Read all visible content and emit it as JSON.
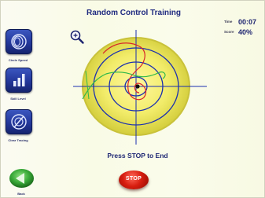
{
  "header": {
    "title": "Random Control Training"
  },
  "stats": {
    "time_label": "Time",
    "time_value": "00:07",
    "score_label": "Score",
    "score_value": "40%"
  },
  "sidebar": {
    "items": [
      {
        "label": "Circle Speed",
        "icon": "concentric-circles-icon"
      },
      {
        "label": "Skill Level",
        "icon": "bar-chart-icon"
      },
      {
        "label": "Clear Tracing",
        "icon": "clear-circle-icon"
      }
    ]
  },
  "target": {
    "zoom_icon": "zoom-in-icon"
  },
  "footer": {
    "prompt": "Press STOP to End",
    "back_label": "Back",
    "stop_label": "STOP"
  },
  "colors": {
    "title": "#1f2a80",
    "target_yellow": "#f4ee6a",
    "ring_blue": "#1a2fb0",
    "trace_red": "#d8242a",
    "trace_green": "#2db84a",
    "button_blue": "#23379a",
    "stop_red": "#d81e10",
    "back_green": "#38a838"
  }
}
